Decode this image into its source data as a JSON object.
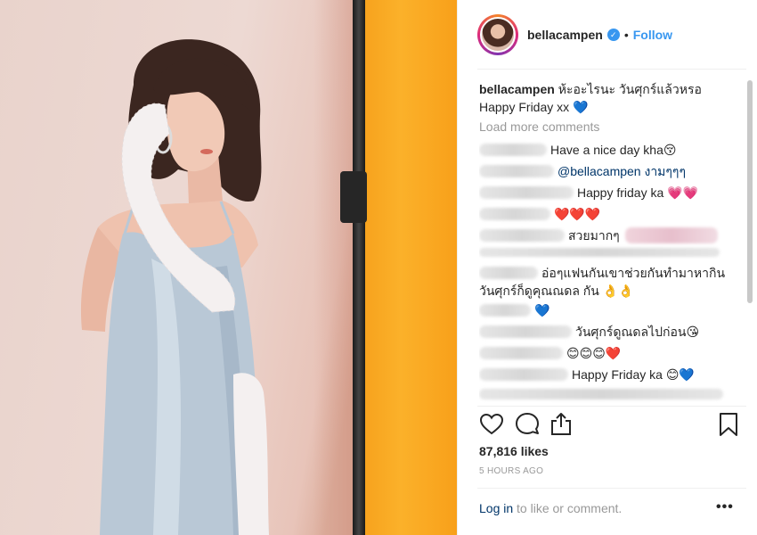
{
  "post": {
    "username": "bellacampen",
    "follow_label": "Follow",
    "dot": "•",
    "verified_glyph": "✓",
    "caption_user": "bellacampen",
    "caption_text": "ห้ะอะไรนะ วันศุกร์แล้วหรอ Happy Friday xx 💙",
    "load_more": "Load more comments",
    "comments": [
      {
        "text": "Have a nice day kha😚"
      },
      {
        "text": "@bellacampen งามๆๆๆ"
      },
      {
        "text": "Happy friday ka 💗💗"
      },
      {
        "text": "❤️❤️❤️"
      },
      {
        "text": "สวยมากๆ"
      },
      {
        "text": "อ่อๆแฟนกันเขาช่วยกันทำมาหากิน"
      },
      {
        "text": "วันศุกร์ก็ดูคุณณดล กัน 👌👌"
      },
      {
        "text": "💙"
      },
      {
        "text": "วันศุกร์ดูณดลไปก่อน😘"
      },
      {
        "text": "😊😊😊❤️"
      },
      {
        "text": "Happy Friday ka 😊💙"
      }
    ],
    "likes": "87,816 likes",
    "time_ago": "5 HOURS AGO",
    "login_link": "Log in",
    "login_rest": " to like or comment.",
    "more_label": "•••",
    "icons": {
      "like": "heart-icon",
      "comment": "comment-icon",
      "share": "share-icon",
      "save": "bookmark-icon"
    },
    "colors": {
      "link": "#3897f0",
      "mention": "#003569",
      "muted": "#999999",
      "backdrop_orange": "#f8a31c"
    }
  }
}
